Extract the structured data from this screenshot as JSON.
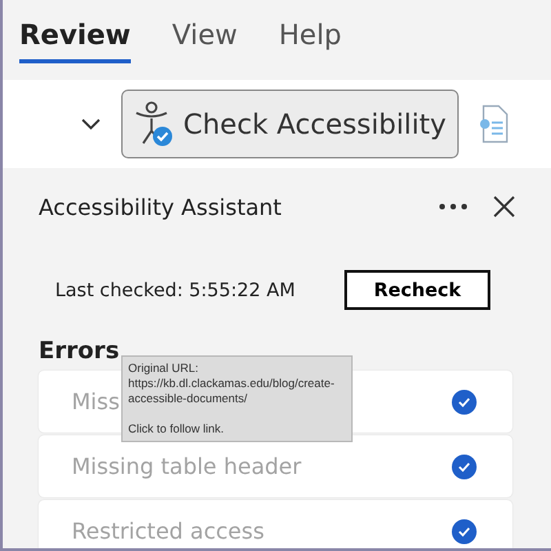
{
  "tabs": [
    {
      "label": "Review",
      "selected": true
    },
    {
      "label": "View",
      "selected": false
    },
    {
      "label": "Help",
      "selected": false
    }
  ],
  "toolbar": {
    "button": "Check Accessibility"
  },
  "panel": {
    "title": "Accessibility Assistant",
    "last_checked": "Last checked: 5:55:22 AM",
    "recheck": "Recheck",
    "section": "Errors",
    "items": [
      {
        "label": "Miss",
        "resolved": true
      },
      {
        "label": "Missing table header",
        "resolved": true
      },
      {
        "label": "Restricted access",
        "resolved": true
      }
    ]
  },
  "tooltip": {
    "lines": [
      "Original URL:",
      "https://kb.dl.clackamas.edu/blog/create-",
      "accessible-documents/"
    ],
    "action": "Click to follow link."
  }
}
